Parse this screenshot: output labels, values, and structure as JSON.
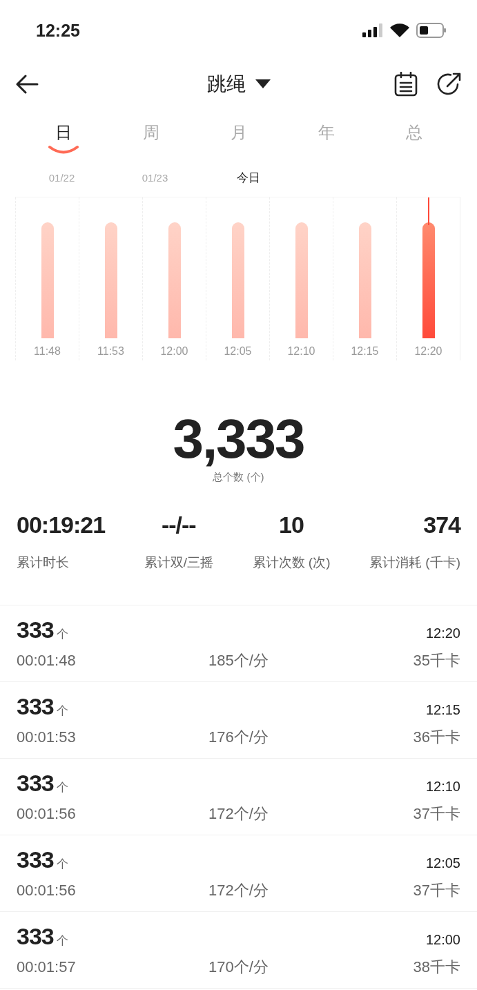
{
  "status_bar": {
    "time": "12:25"
  },
  "header": {
    "title": "跳绳"
  },
  "tabs": [
    {
      "label": "日",
      "selected": true
    },
    {
      "label": "周",
      "selected": false
    },
    {
      "label": "月",
      "selected": false
    },
    {
      "label": "年",
      "selected": false
    },
    {
      "label": "总",
      "selected": false
    }
  ],
  "dates": [
    {
      "label": "01/22",
      "selected": false
    },
    {
      "label": "01/23",
      "selected": false
    },
    {
      "label": "今日",
      "selected": true
    }
  ],
  "chart": {
    "bars": [
      {
        "label": "11:48",
        "selected": false
      },
      {
        "label": "11:53",
        "selected": false
      },
      {
        "label": "12:00",
        "selected": false
      },
      {
        "label": "12:05",
        "selected": false
      },
      {
        "label": "12:10",
        "selected": false
      },
      {
        "label": "12:15",
        "selected": false
      },
      {
        "label": "12:20",
        "selected": true
      }
    ]
  },
  "total": {
    "value": "3,333",
    "label": "总个数 (个)"
  },
  "stats": [
    {
      "value": "00:19:21",
      "label": "累计时长"
    },
    {
      "value": "--/--",
      "label": "累计双/三摇"
    },
    {
      "value": "10",
      "label": "累计次数 (次)"
    },
    {
      "value": "374",
      "label": "累计消耗 (千卡)"
    }
  ],
  "records": [
    {
      "count": "333",
      "unit": "个",
      "time": "12:20",
      "duration": "00:01:48",
      "rate": "185个/分",
      "calories": "35千卡"
    },
    {
      "count": "333",
      "unit": "个",
      "time": "12:15",
      "duration": "00:01:53",
      "rate": "176个/分",
      "calories": "36千卡"
    },
    {
      "count": "333",
      "unit": "个",
      "time": "12:10",
      "duration": "00:01:56",
      "rate": "172个/分",
      "calories": "37千卡"
    },
    {
      "count": "333",
      "unit": "个",
      "time": "12:05",
      "duration": "00:01:56",
      "rate": "172个/分",
      "calories": "37千卡"
    },
    {
      "count": "333",
      "unit": "个",
      "time": "12:00",
      "duration": "00:01:57",
      "rate": "170个/分",
      "calories": "38千卡"
    }
  ]
}
